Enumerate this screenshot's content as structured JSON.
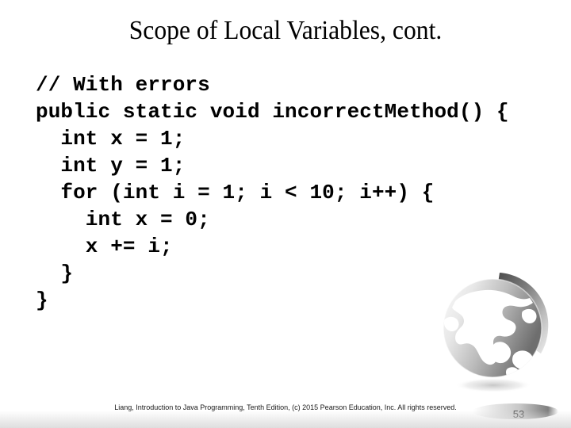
{
  "slide": {
    "title": "Scope of Local Variables, cont.",
    "background_color": "#ffffff",
    "text_color": "#000000"
  },
  "code": {
    "language": "java",
    "lines": [
      "// With errors",
      "public static void incorrectMethod() {",
      "  int x = 1;",
      "  int y = 1;",
      "  for (int i = 1; i < 10; i++) {",
      "    int x = 0;",
      "    x += i;",
      "  }",
      "}"
    ]
  },
  "footer": {
    "copyright": "Liang, Introduction to Java Programming, Tenth Edition, (c) 2015 Pearson Education, Inc. All rights reserved.",
    "page_number": "53",
    "page_number_color": "#5e5e5e"
  },
  "decoration": {
    "globe_icon": "globe-icon",
    "globe_colors": {
      "sphere_light": "#f2f2f2",
      "sphere_dark": "#7a7a7a",
      "land": "#ffffff",
      "arc_dark": "#595959",
      "arc_light": "#d9d9d9"
    }
  }
}
